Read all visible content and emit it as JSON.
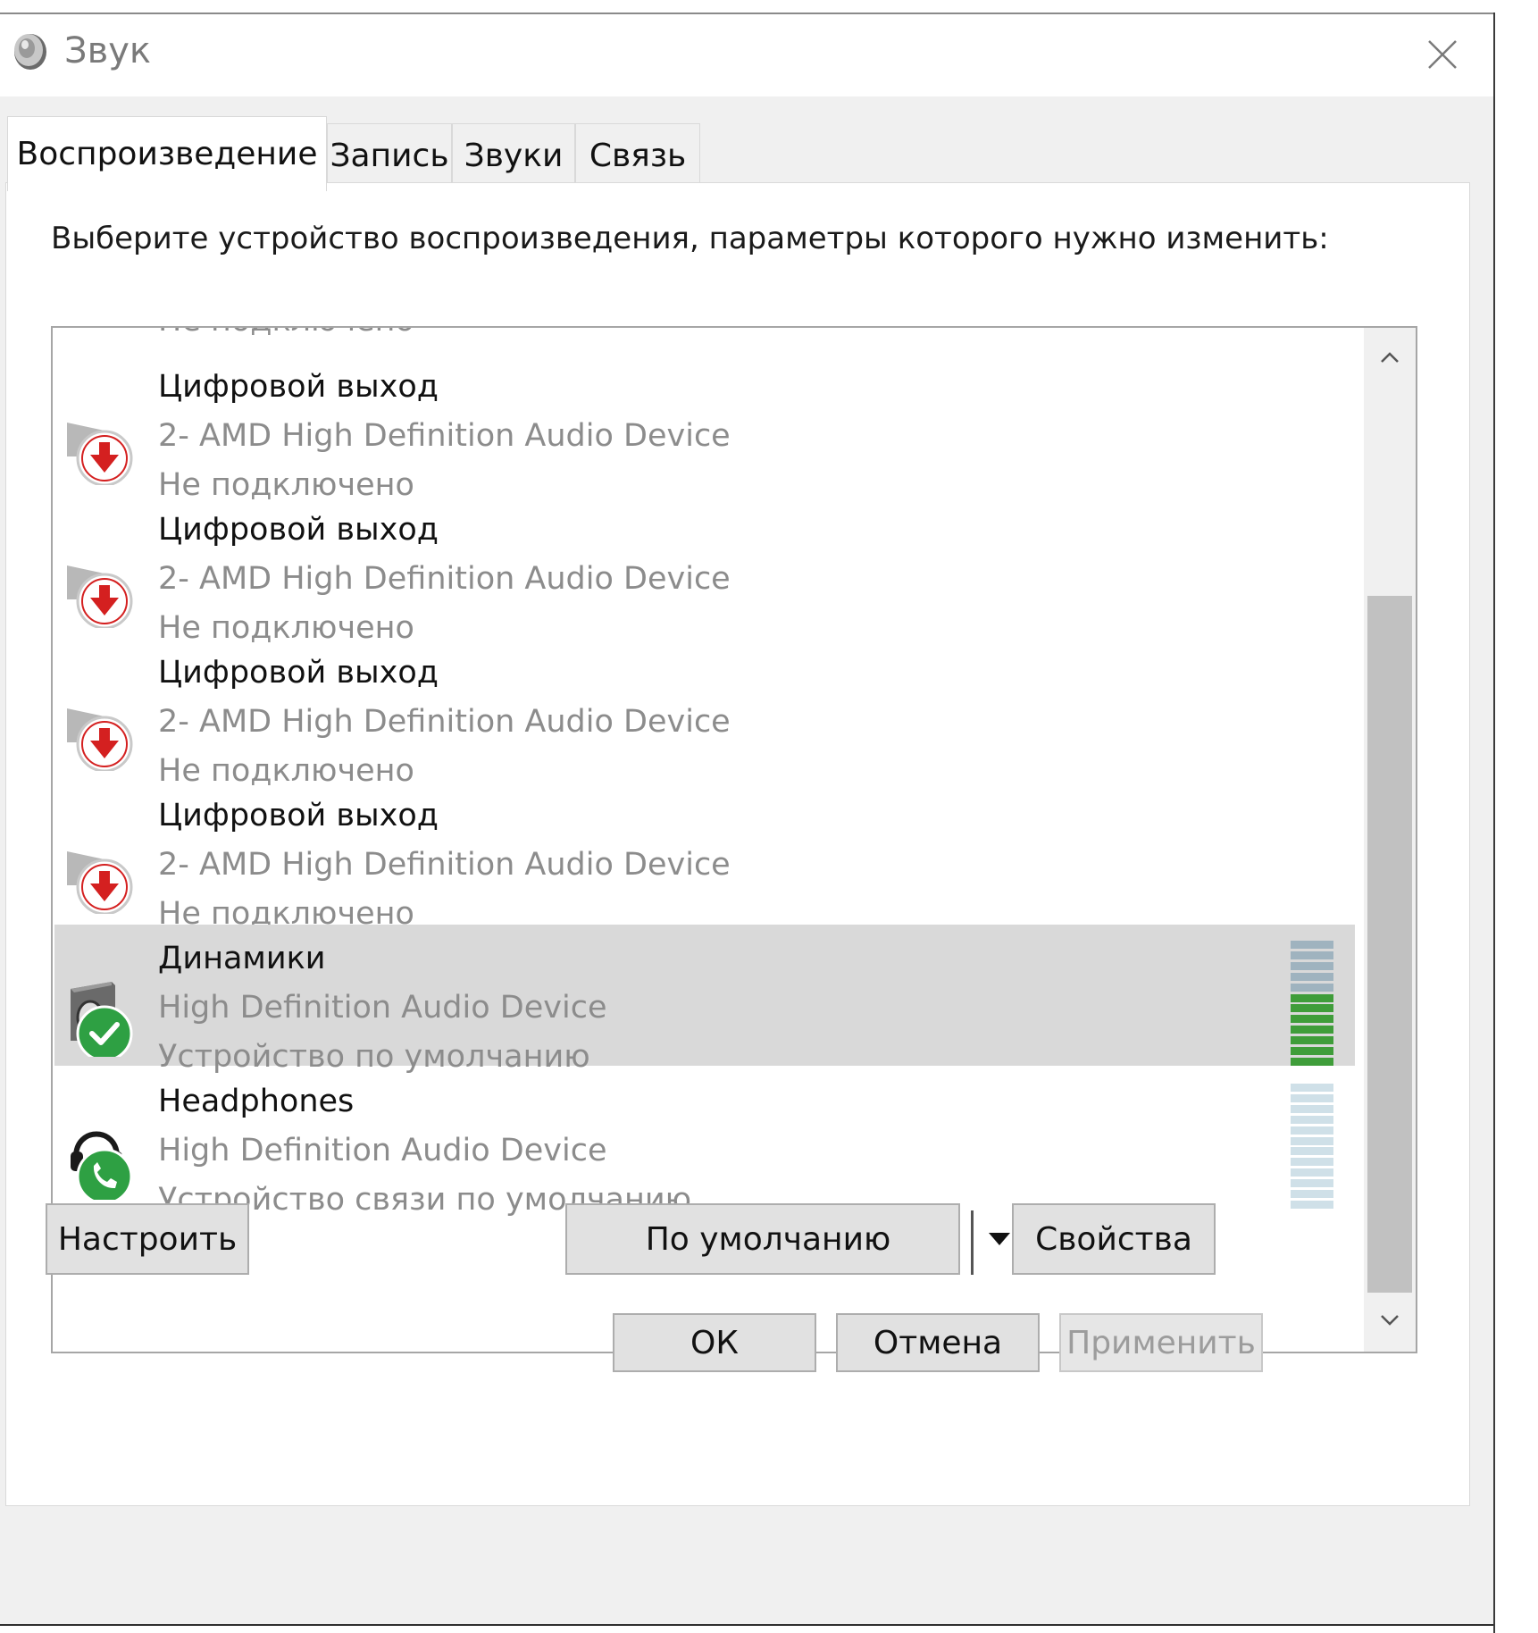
{
  "window": {
    "title": "Звук",
    "close_symbol": "✕"
  },
  "tabs": [
    {
      "label": "Воспроизведение",
      "active": true
    },
    {
      "label": "Запись",
      "active": false
    },
    {
      "label": "Звуки",
      "active": false
    },
    {
      "label": "Связь",
      "active": false
    }
  ],
  "instruction": "Выберите устройство воспроизведения, параметры которого нужно изменить:",
  "devices": {
    "partial_top_status": "Не подключено",
    "items": [
      {
        "name": "Цифровой выход",
        "desc": "2- AMD High Definition Audio Device",
        "status": "Не подключено",
        "icon": "digital-output-disconnected-icon",
        "selected": false
      },
      {
        "name": "Цифровой выход",
        "desc": "2- AMD High Definition Audio Device",
        "status": "Не подключено",
        "icon": "digital-output-disconnected-icon",
        "selected": false
      },
      {
        "name": "Цифровой выход",
        "desc": "2- AMD High Definition Audio Device",
        "status": "Не подключено",
        "icon": "digital-output-disconnected-icon",
        "selected": false
      },
      {
        "name": "Цифровой выход",
        "desc": "2- AMD High Definition Audio Device",
        "status": "Не подключено",
        "icon": "digital-output-disconnected-icon",
        "selected": false
      },
      {
        "name": "Динамики",
        "desc": "High Definition Audio Device",
        "status": "Устройство по умолчанию",
        "icon": "speakers-default-icon",
        "selected": true,
        "level": 0.6
      },
      {
        "name": "Headphones",
        "desc": "High Definition Audio Device",
        "status": "Устройство связи по умолчанию",
        "icon": "headphones-communication-icon",
        "selected": false,
        "level": 0
      }
    ]
  },
  "buttons": {
    "configure": "Настроить",
    "set_default": "По умолчанию",
    "properties": "Свойства",
    "ok": "ОК",
    "cancel": "Отмена",
    "apply": "Применить"
  },
  "colors": {
    "selected_row": "#d9d9d9",
    "meter_active": "#3f9d3a",
    "meter_idle_selected": "#9fb3bf",
    "meter_idle": "#cfe0e8",
    "disconnected_red": "#d42020",
    "default_green": "#2ea043"
  }
}
